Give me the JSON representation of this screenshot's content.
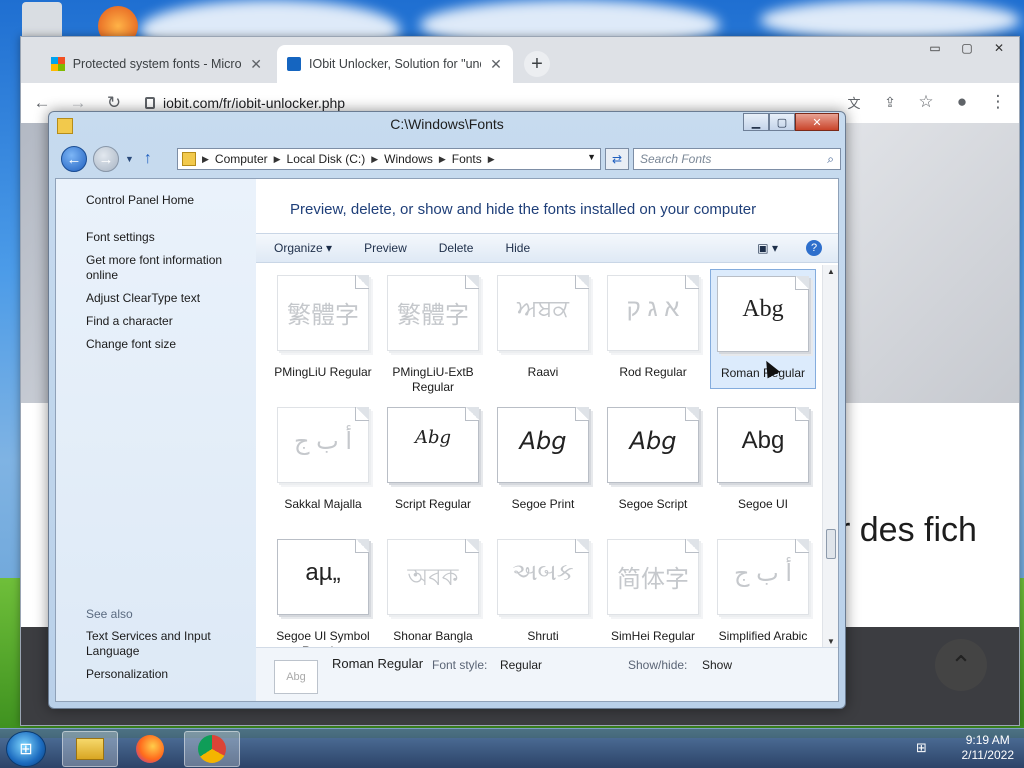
{
  "chrome": {
    "tabs": [
      {
        "title": "Protected system fonts - Microso",
        "close": "✕",
        "active": false,
        "favicon_color": "#f25022"
      },
      {
        "title": "IObit Unlocker, Solution for \"und",
        "close": "✕",
        "active": true,
        "favicon_color": "#1565c0"
      }
    ],
    "new_tab": "+",
    "url": "iobit.com/fr/iobit-unlocker.php",
    "page_big_text": "r des fich",
    "scroll_top_icon": "⌃",
    "window_controls": {
      "minimize": "▭",
      "maximize": "▢",
      "close": "✕"
    }
  },
  "fonts_window": {
    "title": "C:\\Windows\\Fonts",
    "breadcrumb": [
      "Computer",
      "Local Disk (C:)",
      "Windows",
      "Fonts"
    ],
    "search_placeholder": "Search Fonts",
    "left_pane": {
      "links": [
        "Control Panel Home",
        "Font settings",
        "Get more font information online",
        "Adjust ClearType text",
        "Find a character",
        "Change font size"
      ],
      "see_also_label": "See also",
      "see_also_links": [
        "Text Services and Input Language",
        "Personalization"
      ]
    },
    "header": "Preview, delete, or show and hide the fonts installed on your computer",
    "commands": [
      "Organize ▾",
      "Preview",
      "Delete",
      "Hide"
    ],
    "help": "?",
    "fonts": [
      {
        "glyph": "繁體字",
        "label": "PMingLiU Regular",
        "faded": true
      },
      {
        "glyph": "繁體字",
        "label": "PMingLiU-ExtB Regular",
        "faded": true
      },
      {
        "glyph": "ਅਬਕ",
        "label": "Raavi",
        "faded": true
      },
      {
        "glyph": "א ג ק",
        "label": "Rod Regular",
        "faded": true
      },
      {
        "glyph": "Abg",
        "label": "Roman Regular",
        "faded": false,
        "selected": true
      },
      {
        "glyph": "أ ب ج",
        "label": "Sakkal Majalla",
        "faded": true
      },
      {
        "glyph": "Abg",
        "label": "Script Regular",
        "faded": false
      },
      {
        "glyph": "Abg",
        "label": "Segoe Print",
        "faded": false
      },
      {
        "glyph": "Abg",
        "label": "Segoe Script",
        "faded": false
      },
      {
        "glyph": "Abg",
        "label": "Segoe UI",
        "faded": false
      },
      {
        "glyph": "aµ„",
        "label": "Segoe UI Symbol Regular",
        "faded": false
      },
      {
        "glyph": "অবক",
        "label": "Shonar Bangla",
        "faded": true
      },
      {
        "glyph": "અબક",
        "label": "Shruti",
        "faded": true
      },
      {
        "glyph": "简体字",
        "label": "SimHei Regular",
        "faded": true
      },
      {
        "glyph": "أ ب ج",
        "label": "Simplified Arabic",
        "faded": true
      }
    ],
    "details": {
      "thumb_glyph": "Abg",
      "name": "Roman Regular",
      "font_style_label": "Font style:",
      "font_style_value": "Regular",
      "show_hide_label": "Show/hide:",
      "show_hide_value": "Show"
    }
  },
  "taskbar": {
    "start_icon": "⊞",
    "apps": [
      "explorer-icon",
      "firefox-icon",
      "chrome-icon"
    ],
    "time": "9:19 AM",
    "date": "2/11/2022"
  }
}
